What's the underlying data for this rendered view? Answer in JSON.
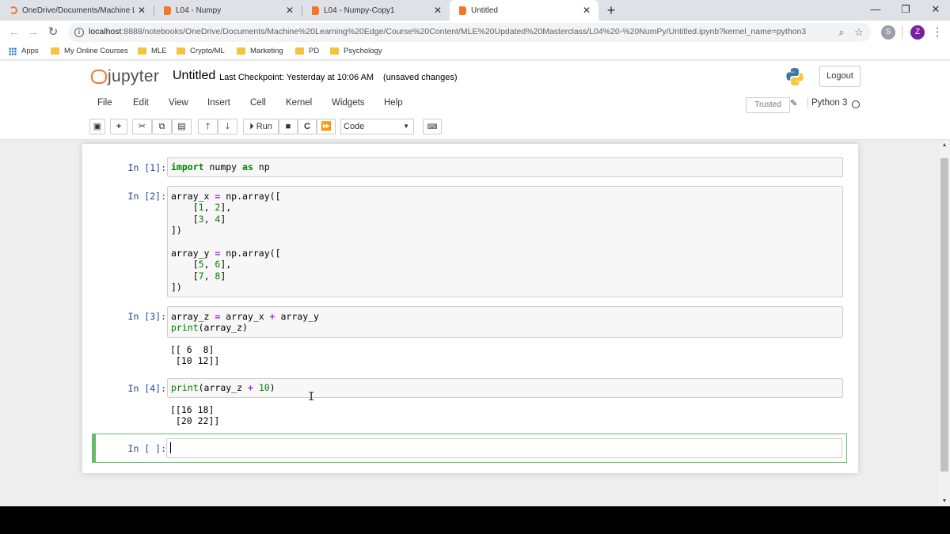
{
  "browser": {
    "tabs": [
      {
        "title": "OneDrive/Documents/Machine L",
        "icon": "jupyter-loading-icon"
      },
      {
        "title": "L04 - Numpy",
        "icon": "jupyter-book-icon"
      },
      {
        "title": "L04 - Numpy-Copy1",
        "icon": "jupyter-book-icon"
      },
      {
        "title": "Untitled",
        "icon": "jupyter-book-icon"
      }
    ],
    "new_tab": "+",
    "url_host": "localhost",
    "url_rest": ":8888/notebooks/OneDrive/Documents/Machine%20Learning%20Edge/Course%20Content/MLE%20Updated%20Masterclass/L04%20-%20NumPy/Untitled.ipynb?kernel_name=python3",
    "profile_initial": "Z",
    "bookmarks": [
      "Apps",
      "My Online Courses",
      "MLE",
      "Crypto/ML",
      "Marketing",
      "PD",
      "Psychology"
    ]
  },
  "jupyter": {
    "logo_text": "jupyter",
    "notebook_name": "Untitled",
    "checkpoint": "Last Checkpoint: Yesterday at 10:06 AM",
    "unsaved": "(unsaved changes)",
    "logout": "Logout",
    "menu": [
      "File",
      "Edit",
      "View",
      "Insert",
      "Cell",
      "Kernel",
      "Widgets",
      "Help"
    ],
    "trusted": "Trusted",
    "kernel": "Python 3",
    "run_label": "Run",
    "cell_type": "Code"
  },
  "cells": {
    "c1": {
      "prompt": "In [1]:"
    },
    "c2": {
      "prompt": "In [2]:"
    },
    "c3": {
      "prompt": "In [3]:",
      "output": "[[ 6  8]\n [10 12]]"
    },
    "c4": {
      "prompt": "In [4]:",
      "output": "[[16 18]\n [20 22]]"
    },
    "c5": {
      "prompt": "In [ ]:"
    }
  },
  "colors": {
    "accent": "#f37726",
    "prompt": "#303f9f",
    "selected": "#66bb6a"
  }
}
